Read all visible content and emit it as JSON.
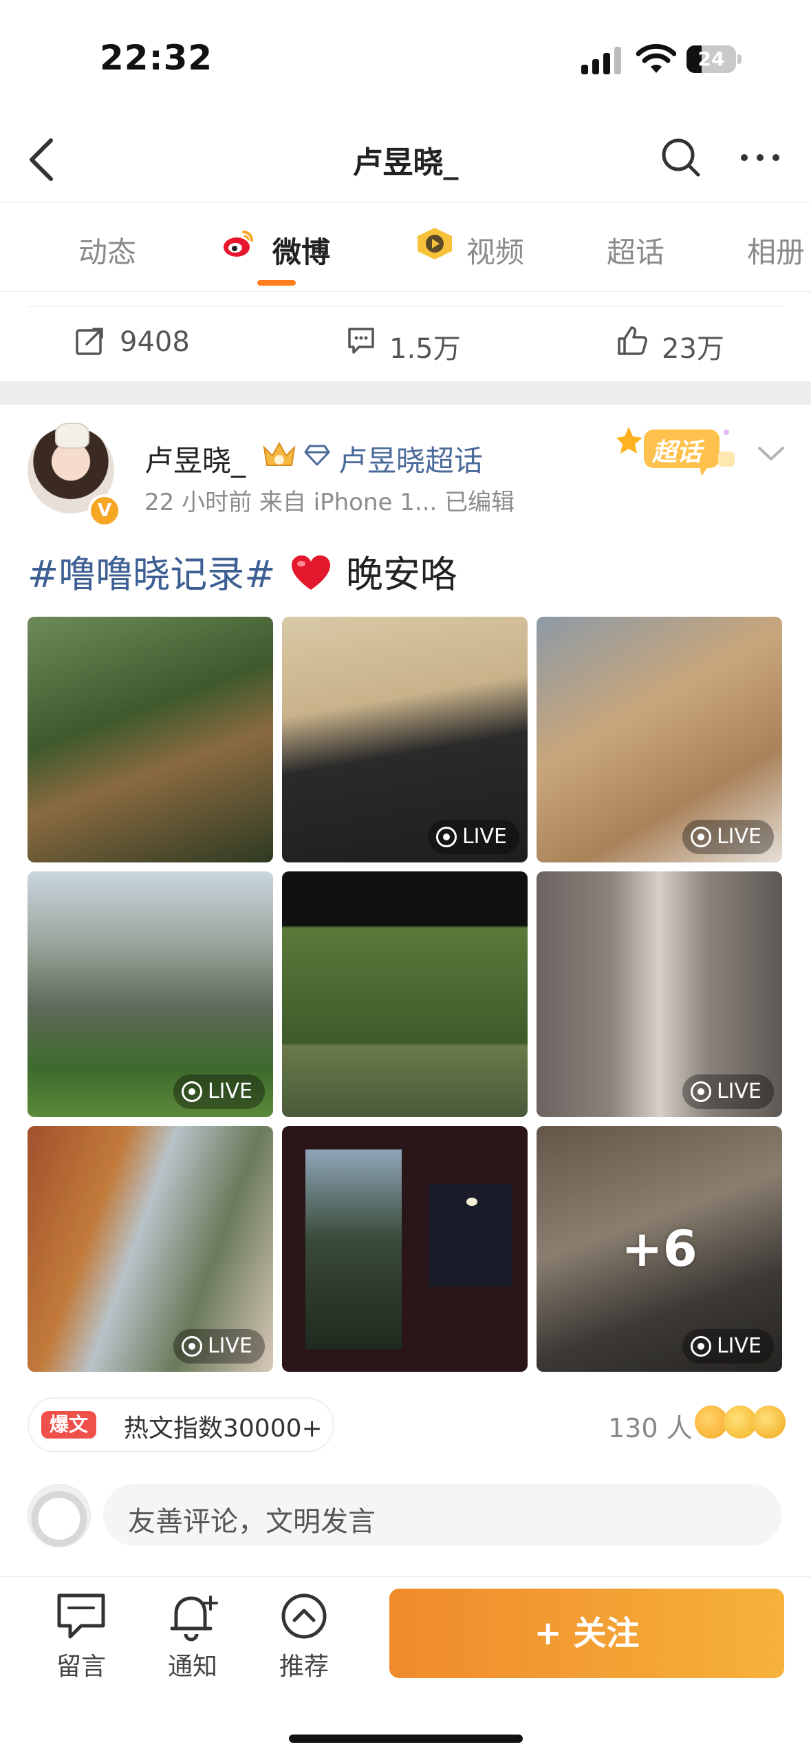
{
  "status_bar": {
    "time": "22:32",
    "battery": "24"
  },
  "nav": {
    "title": "卢昱晓_"
  },
  "tabs": [
    {
      "label": "动态"
    },
    {
      "label": "微博"
    },
    {
      "label": "视频"
    },
    {
      "label": "超话"
    },
    {
      "label": "相册"
    }
  ],
  "stats": {
    "reposts": "9408",
    "comments": "1.5万",
    "likes": "23万"
  },
  "post": {
    "user_name": "卢昱晓_",
    "topic_link": "卢昱晓超话",
    "meta": "22 小时前  来自 iPhone 1...  已编辑",
    "badge_text": "超话",
    "hashtag": "#噜噜晓记录#",
    "text": "晚安咯",
    "photos": [
      {
        "live": false
      },
      {
        "live": true,
        "live_label": "LIVE"
      },
      {
        "live": true,
        "live_label": "LIVE"
      },
      {
        "live": true,
        "live_label": "LIVE"
      },
      {
        "live": false
      },
      {
        "live": true,
        "live_label": "LIVE"
      },
      {
        "live": true,
        "live_label": "LIVE"
      },
      {
        "live": false
      },
      {
        "live": true,
        "live_label": "LIVE",
        "more": "+6"
      }
    ]
  },
  "hot": {
    "tag": "爆文",
    "text": "热文指数30000+",
    "reactions": "130 人"
  },
  "comment": {
    "placeholder": "友善评论，文明发言"
  },
  "bottom_bar": {
    "message": "留言",
    "notify": "通知",
    "recommend": "推荐",
    "follow": "+ 关注"
  },
  "colors": {
    "accent": "#ff7f1f",
    "link": "#4a6a9a",
    "follow_start": "#f08a2c",
    "follow_end": "#f6b23a"
  }
}
